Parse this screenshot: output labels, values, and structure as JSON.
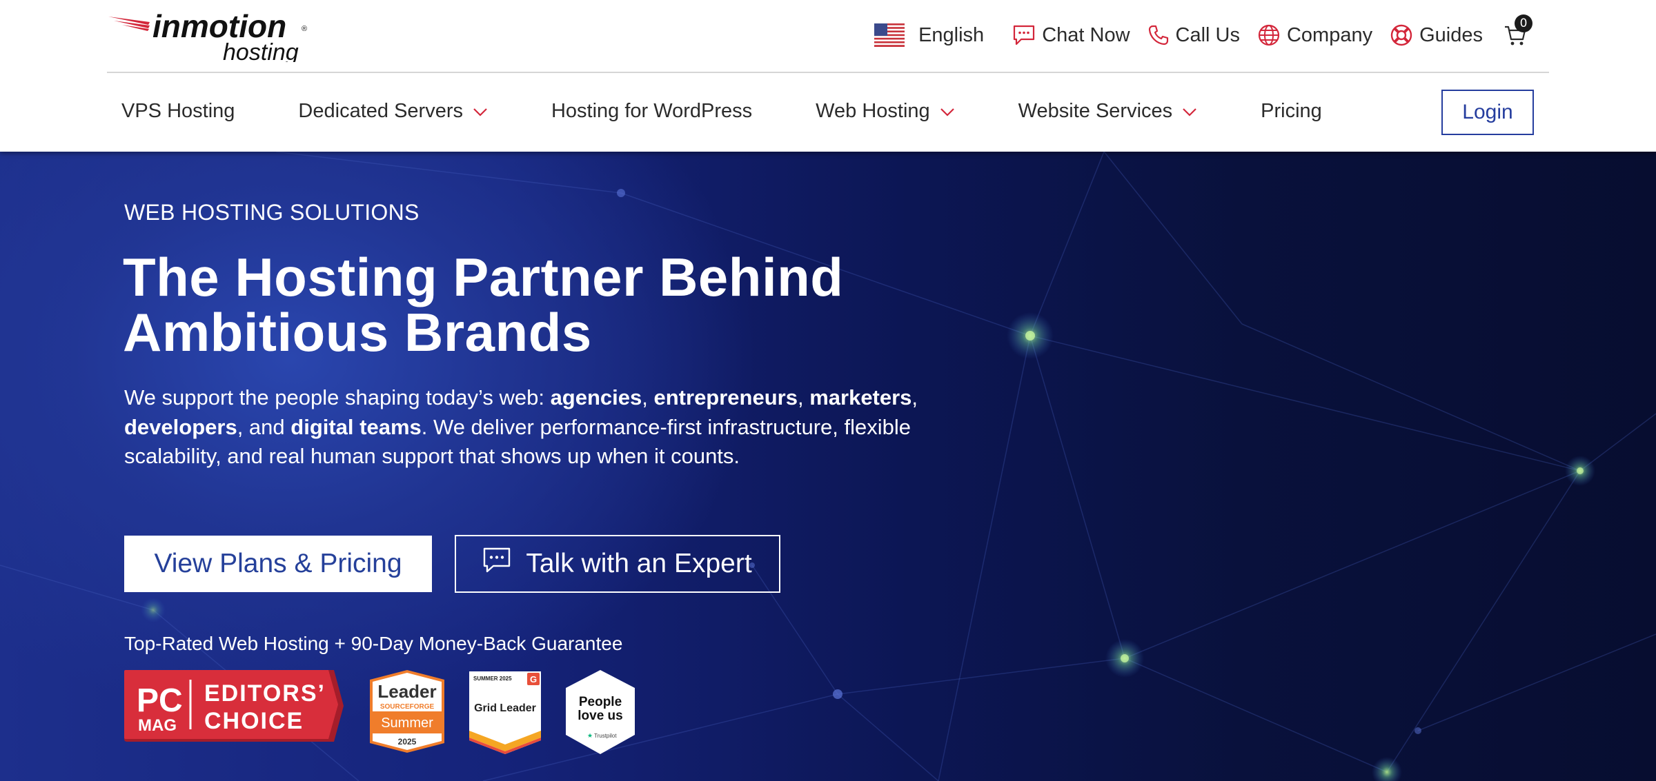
{
  "brand": {
    "name": "inmotion",
    "sub": "hosting",
    "reg": "®"
  },
  "utility_nav": {
    "language": "English",
    "chat": "Chat Now",
    "call": "Call Us",
    "company": "Company",
    "guides": "Guides",
    "cart_count": "0"
  },
  "main_nav": {
    "items": [
      {
        "label": "VPS Hosting",
        "dropdown": false
      },
      {
        "label": "Dedicated Servers",
        "dropdown": true
      },
      {
        "label": "Hosting for WordPress",
        "dropdown": false
      },
      {
        "label": "Web Hosting",
        "dropdown": true
      },
      {
        "label": "Website Services",
        "dropdown": true
      },
      {
        "label": "Pricing",
        "dropdown": false
      }
    ],
    "login": "Login"
  },
  "hero": {
    "eyebrow": "WEB HOSTING SOLUTIONS",
    "headline_line1": "The Hosting Partner Behind",
    "headline_line2": "Ambitious Brands",
    "lead": {
      "p1": "We support the people shaping today’s web: ",
      "b1": "agencies",
      "p2": ", ",
      "b2": "entrepreneurs",
      "p3": ", ",
      "b3": "marketers",
      "p4": ", ",
      "b4": "developers",
      "p5": ", and ",
      "b5": "digital teams",
      "p6": ". We deliver performance-first infrastructure, flexible scalability, and real human support that shows up when it counts."
    },
    "cta_primary": "View Plans & Pricing",
    "cta_secondary": "Talk with an Expert",
    "guarantee": "Top-Rated Web Hosting + 90-Day Money-Back Guarantee"
  },
  "badges": {
    "pcmag": {
      "pc": "PC",
      "mag": "MAG",
      "line1": "EDITORS’",
      "line2": "CHOICE"
    },
    "sourceforge": {
      "line1": "Leader",
      "line2": "SOURCEFORGE",
      "line3": "Summer",
      "line4": "2025"
    },
    "g2": {
      "top": "SUMMER 2025",
      "mark": "G",
      "label": "Grid Leader"
    },
    "trustpilot": {
      "line1": "People",
      "line2": "love us",
      "small": "Trustpilot"
    }
  },
  "colors": {
    "brand_red": "#d3263a",
    "link_blue": "#253d9e",
    "hero_dark": "#0a1240",
    "hero_light": "#2a46ae"
  },
  "icons": [
    "us-flag-icon",
    "chat-icon",
    "phone-icon",
    "globe-icon",
    "lifebuoy-icon",
    "cart-icon",
    "chevron-down-icon"
  ]
}
